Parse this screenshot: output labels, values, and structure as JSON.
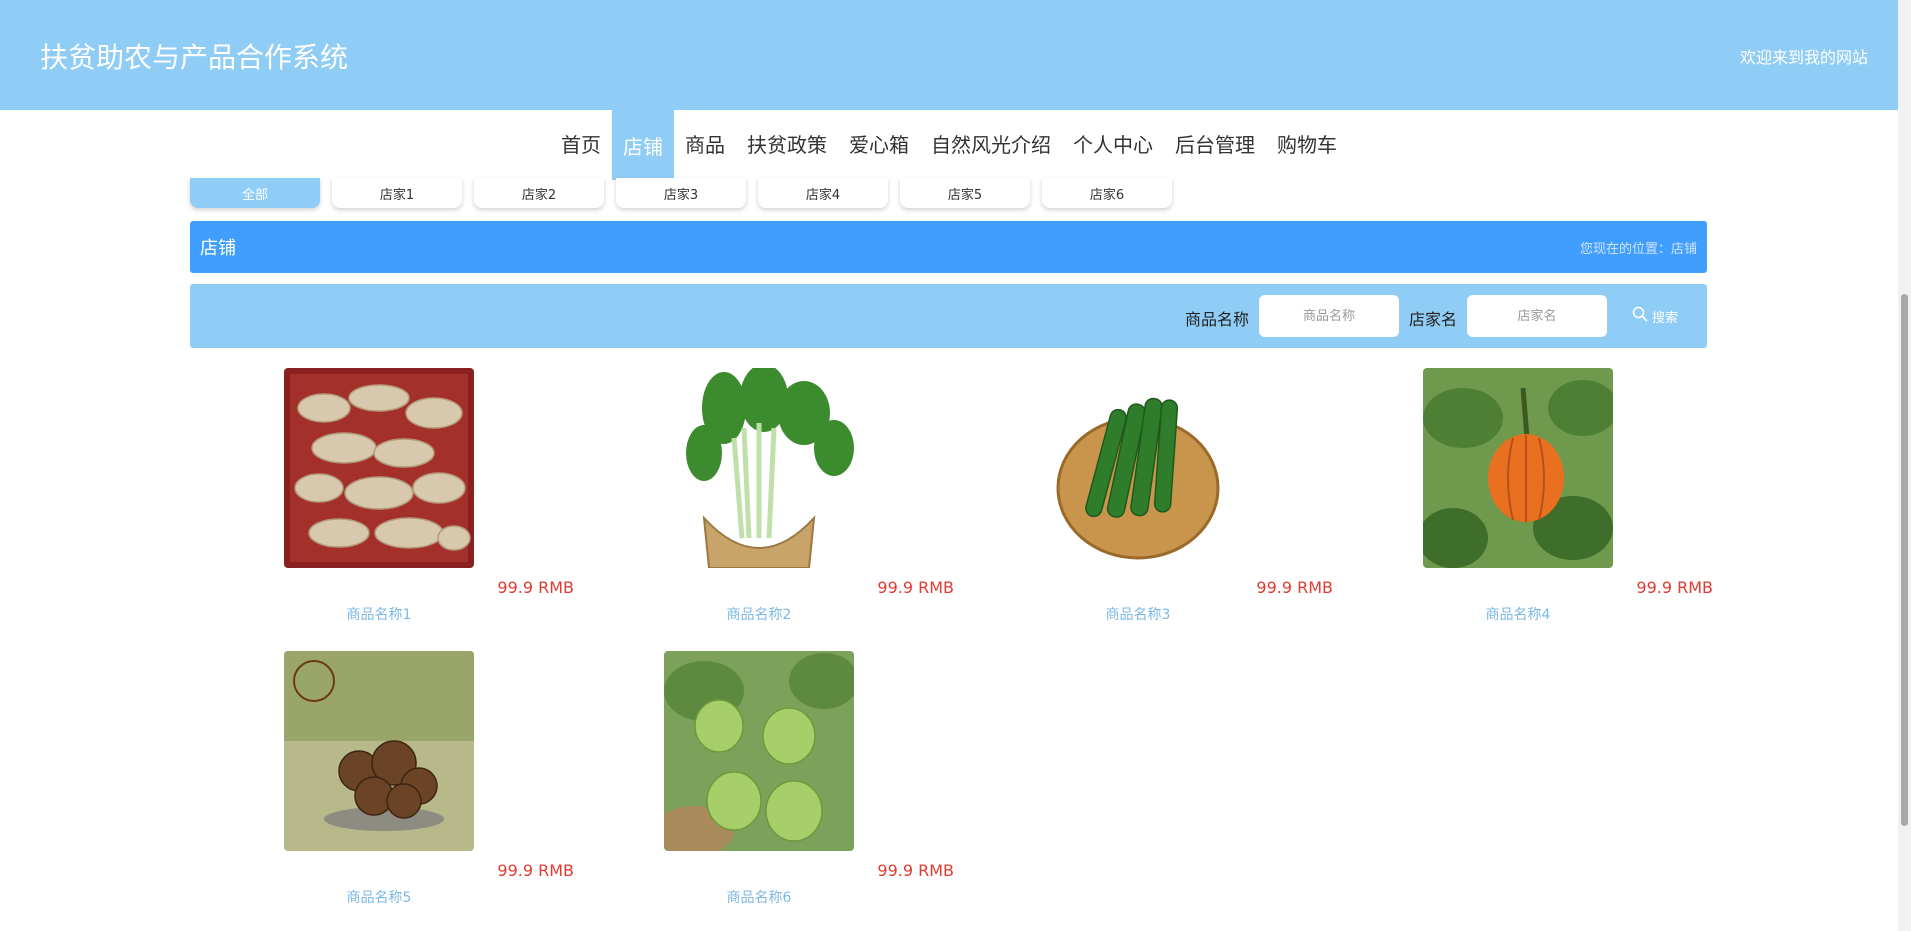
{
  "header": {
    "site_title": "扶贫助农与产品合作系统",
    "welcome": "欢迎来到我的网站",
    "bg_color": "#90CDF6"
  },
  "nav": {
    "items": [
      "首页",
      "店铺",
      "商品",
      "扶贫政策",
      "爱心箱",
      "自然风光介绍",
      "个人中心",
      "后台管理",
      "购物车"
    ],
    "active": "店铺"
  },
  "filters": {
    "items": [
      "全部",
      "店家1",
      "店家2",
      "店家3",
      "店家4",
      "店家5",
      "店家6"
    ],
    "active": "全部"
  },
  "section": {
    "title": "店铺",
    "breadcrumb": "您现在的位置：店铺",
    "bg_color": "#409EFF"
  },
  "search": {
    "product_label": "商品名称",
    "product_placeholder": "商品名称",
    "shop_label": "店家名",
    "shop_placeholder": "店家名",
    "button_label": "搜索",
    "button_icon": "search-icon"
  },
  "products": [
    {
      "name": "商品名称1",
      "price": "99.9 RMB",
      "image": "ginger"
    },
    {
      "name": "商品名称2",
      "price": "99.9 RMB",
      "image": "leafy-greens-basket"
    },
    {
      "name": "商品名称3",
      "price": "99.9 RMB",
      "image": "cucumbers-basket"
    },
    {
      "name": "商品名称4",
      "price": "99.9 RMB",
      "image": "pumpkin-on-vine"
    },
    {
      "name": "商品名称5",
      "price": "99.9 RMB",
      "image": "shiitake-mushrooms"
    },
    {
      "name": "商品名称6",
      "price": "99.9 RMB",
      "image": "green-gourds-on-vine"
    }
  ],
  "colors": {
    "price": "#E03C31",
    "product_name": "#7BB8E5"
  }
}
